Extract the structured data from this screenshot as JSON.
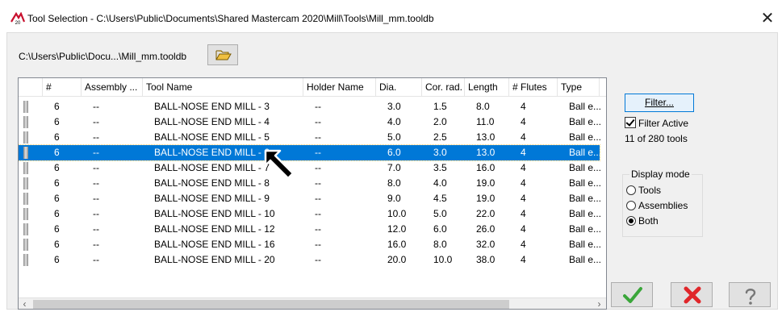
{
  "window": {
    "title": "Tool Selection - C:\\Users\\Public\\Documents\\Shared Mastercam 2020\\Mill\\Tools\\Mill_mm.tooldb",
    "app_icon_text": "20"
  },
  "library": {
    "path": "C:\\Users\\Public\\Docu...\\Mill_mm.tooldb"
  },
  "columns": [
    "#",
    "Assembly ...",
    "Tool Name",
    "Holder Name",
    "Dia.",
    "Cor. rad.",
    "Length",
    "# Flutes",
    "Type"
  ],
  "rows": [
    {
      "num": "6",
      "assembly": "--",
      "name": "BALL-NOSE END MILL - 3",
      "holder": "--",
      "dia": "3.0",
      "cor": "1.5",
      "length": "8.0",
      "flutes": "4",
      "type": "Ball e..."
    },
    {
      "num": "6",
      "assembly": "--",
      "name": "BALL-NOSE END MILL - 4",
      "holder": "--",
      "dia": "4.0",
      "cor": "2.0",
      "length": "11.0",
      "flutes": "4",
      "type": "Ball e..."
    },
    {
      "num": "6",
      "assembly": "--",
      "name": "BALL-NOSE END MILL - 5",
      "holder": "--",
      "dia": "5.0",
      "cor": "2.5",
      "length": "13.0",
      "flutes": "4",
      "type": "Ball e..."
    },
    {
      "num": "6",
      "assembly": "--",
      "name": "BALL-NOSE END MILL - 6",
      "holder": "--",
      "dia": "6.0",
      "cor": "3.0",
      "length": "13.0",
      "flutes": "4",
      "type": "Ball e..."
    },
    {
      "num": "6",
      "assembly": "--",
      "name": "BALL-NOSE END MILL - 7",
      "holder": "--",
      "dia": "7.0",
      "cor": "3.5",
      "length": "16.0",
      "flutes": "4",
      "type": "Ball e..."
    },
    {
      "num": "6",
      "assembly": "--",
      "name": "BALL-NOSE END MILL - 8",
      "holder": "--",
      "dia": "8.0",
      "cor": "4.0",
      "length": "19.0",
      "flutes": "4",
      "type": "Ball e..."
    },
    {
      "num": "6",
      "assembly": "--",
      "name": "BALL-NOSE END MILL - 9",
      "holder": "--",
      "dia": "9.0",
      "cor": "4.5",
      "length": "19.0",
      "flutes": "4",
      "type": "Ball e..."
    },
    {
      "num": "6",
      "assembly": "--",
      "name": "BALL-NOSE END MILL - 10",
      "holder": "--",
      "dia": "10.0",
      "cor": "5.0",
      "length": "22.0",
      "flutes": "4",
      "type": "Ball e..."
    },
    {
      "num": "6",
      "assembly": "--",
      "name": "BALL-NOSE END MILL - 12",
      "holder": "--",
      "dia": "12.0",
      "cor": "6.0",
      "length": "26.0",
      "flutes": "4",
      "type": "Ball e..."
    },
    {
      "num": "6",
      "assembly": "--",
      "name": "BALL-NOSE END MILL - 16",
      "holder": "--",
      "dia": "16.0",
      "cor": "8.0",
      "length": "32.0",
      "flutes": "4",
      "type": "Ball e..."
    },
    {
      "num": "6",
      "assembly": "--",
      "name": "BALL-NOSE END MILL - 20",
      "holder": "--",
      "dia": "20.0",
      "cor": "10.0",
      "length": "38.0",
      "flutes": "4",
      "type": "Ball e..."
    }
  ],
  "selected_row": 3,
  "filter": {
    "button_label": "Filter...",
    "active_label": "Filter Active",
    "active": true,
    "count_text": "11 of 280 tools"
  },
  "display_mode": {
    "legend": "Display mode",
    "options": [
      "Tools",
      "Assemblies",
      "Both"
    ],
    "selected": "Both"
  },
  "colors": {
    "selection": "#0078d7",
    "ok_check": "#3aa63a",
    "cancel_x": "#e0262a"
  },
  "icons": [
    "app-icon",
    "folder-open-icon",
    "tool-icon",
    "ok-check-icon",
    "cancel-x-icon",
    "help-question-icon",
    "mouse-cursor-icon"
  ]
}
